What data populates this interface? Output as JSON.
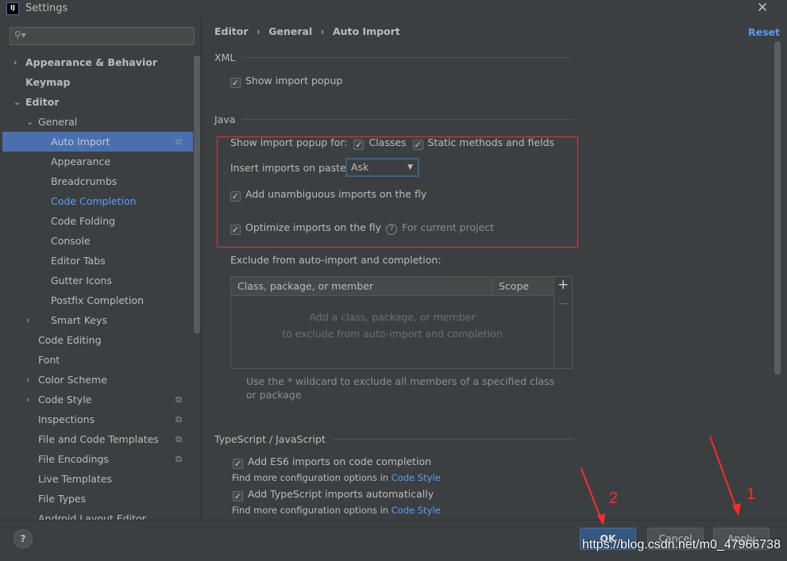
{
  "window": {
    "title": "Settings",
    "logo": "IJ",
    "close_icon": "close-icon"
  },
  "search": {
    "placeholder": "",
    "icon": "search-icon"
  },
  "sidebar": {
    "items": [
      {
        "label": "Appearance & Behavior",
        "level": 0,
        "arrow": "›",
        "bold": true
      },
      {
        "label": "Keymap",
        "level": 0,
        "arrow": "",
        "bold": true
      },
      {
        "label": "Editor",
        "level": 0,
        "arrow": "⌄",
        "bold": true
      },
      {
        "label": "General",
        "level": 1,
        "arrow": "⌄"
      },
      {
        "label": "Auto Import",
        "level": 2,
        "selected": true,
        "copy": true
      },
      {
        "label": "Appearance",
        "level": 2
      },
      {
        "label": "Breadcrumbs",
        "level": 2
      },
      {
        "label": "Code Completion",
        "level": 2,
        "highlight": true
      },
      {
        "label": "Code Folding",
        "level": 2
      },
      {
        "label": "Console",
        "level": 2
      },
      {
        "label": "Editor Tabs",
        "level": 2
      },
      {
        "label": "Gutter Icons",
        "level": 2
      },
      {
        "label": "Postfix Completion",
        "level": 2
      },
      {
        "label": "Smart Keys",
        "level": 2,
        "arrow": "›",
        "arrowlevel": 1
      },
      {
        "label": "Code Editing",
        "level": 1
      },
      {
        "label": "Font",
        "level": 1
      },
      {
        "label": "Color Scheme",
        "level": 1,
        "arrow": "›"
      },
      {
        "label": "Code Style",
        "level": 1,
        "arrow": "›",
        "copy": true
      },
      {
        "label": "Inspections",
        "level": 1,
        "copy": true
      },
      {
        "label": "File and Code Templates",
        "level": 1,
        "copy": true
      },
      {
        "label": "File Encodings",
        "level": 1,
        "copy": true
      },
      {
        "label": "Live Templates",
        "level": 1
      },
      {
        "label": "File Types",
        "level": 1
      },
      {
        "label": "Android Layout Editor",
        "level": 1
      }
    ]
  },
  "breadcrumb": {
    "items": [
      "Editor",
      "General",
      "Auto Import"
    ],
    "separator": "›"
  },
  "reset_label": "Reset",
  "xml": {
    "title": "XML",
    "show_import_popup": {
      "label": "Show import popup",
      "checked": true
    }
  },
  "java": {
    "title": "Java",
    "show_popup_label": "Show import popup for:",
    "classes": {
      "label": "Classes",
      "checked": true
    },
    "static": {
      "label": "Static methods and fields",
      "checked": true
    },
    "insert_label": "Insert imports on paste:",
    "insert_value": "Ask",
    "unambiguous": {
      "label": "Add unambiguous imports on the fly",
      "checked": true
    },
    "optimize": {
      "label": "Optimize imports on the fly",
      "checked": true
    },
    "optimize_hint": "For current project",
    "exclude_label": "Exclude from auto-import and completion:",
    "table": {
      "columns": [
        "Class, package, or member",
        "Scope"
      ],
      "empty_line1": "Add a class, package, or member",
      "empty_line2": "to exclude from auto-import and completion",
      "add": "+",
      "remove": "−"
    },
    "wildcard_hint": "Use the * wildcard to exclude all members of a specified class or package"
  },
  "ts": {
    "title": "TypeScript / JavaScript",
    "es6": {
      "label": "Add ES6 imports on code completion",
      "checked": true
    },
    "find1": "Find more configuration options in",
    "link1": "Code Style",
    "tsauto": {
      "label": "Add TypeScript imports automatically",
      "checked": true
    },
    "find2": "Find more configuration options in",
    "link2": "Code Style"
  },
  "footer": {
    "help": "?",
    "ok": "OK",
    "cancel": "Cancel",
    "apply": "Apply"
  },
  "annotations": {
    "one": "1",
    "two": "2",
    "color": "#ff2a2a"
  },
  "watermark": "https://blog.csdn.net/m0_47966738",
  "colors": {
    "accent": "#4b6eaf",
    "link": "#589df6",
    "highlight_box": "#e0353b",
    "background": "#3c3f41"
  }
}
